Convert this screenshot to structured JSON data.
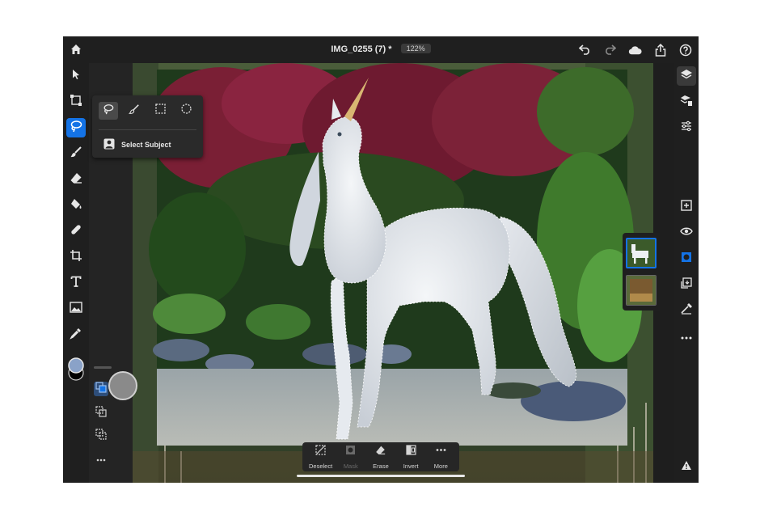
{
  "document": {
    "title": "IMG_0255 (7) *",
    "zoom": "122%"
  },
  "icons": {
    "home": "home-icon",
    "undo": "undo-icon",
    "redo": "redo-icon",
    "cloud": "cloud-icon",
    "share": "share-icon",
    "help": "help-icon"
  },
  "left_tools": [
    {
      "name": "select-tool",
      "icon": "arrow-icon"
    },
    {
      "name": "transform-tool",
      "icon": "transform-icon"
    },
    {
      "name": "lasso-tool",
      "icon": "lasso-icon",
      "active": true
    },
    {
      "name": "brush-tool",
      "icon": "brush-icon"
    },
    {
      "name": "eraser-tool",
      "icon": "eraser-icon"
    },
    {
      "name": "fill-tool",
      "icon": "bucket-icon"
    },
    {
      "name": "healing-tool",
      "icon": "bandage-icon"
    },
    {
      "name": "crop-tool",
      "icon": "crop-icon"
    },
    {
      "name": "type-tool",
      "icon": "type-icon"
    },
    {
      "name": "place-image-tool",
      "icon": "image-icon"
    },
    {
      "name": "eyedropper-tool",
      "icon": "eyedropper-icon"
    }
  ],
  "colors": {
    "foreground": "#8aa2c8",
    "background": "#000000",
    "accent": "#1473e6"
  },
  "selection_popup": {
    "options": [
      "lasso-select",
      "brush-select",
      "rect-select",
      "ellipse-select"
    ],
    "select_subject_label": "Select Subject"
  },
  "bottom_bar": {
    "items": [
      {
        "label": "Deselect",
        "enabled": true
      },
      {
        "label": "Mask",
        "enabled": false
      },
      {
        "label": "Erase",
        "enabled": true
      },
      {
        "label": "Invert",
        "enabled": true
      },
      {
        "label": "More",
        "enabled": true
      }
    ]
  },
  "right_tools": [
    "layers-icon",
    "layer-properties-icon",
    "adjustments-icon",
    "add-layer-icon",
    "visibility-icon",
    "mask-icon",
    "arrange-icon",
    "more-icon"
  ]
}
